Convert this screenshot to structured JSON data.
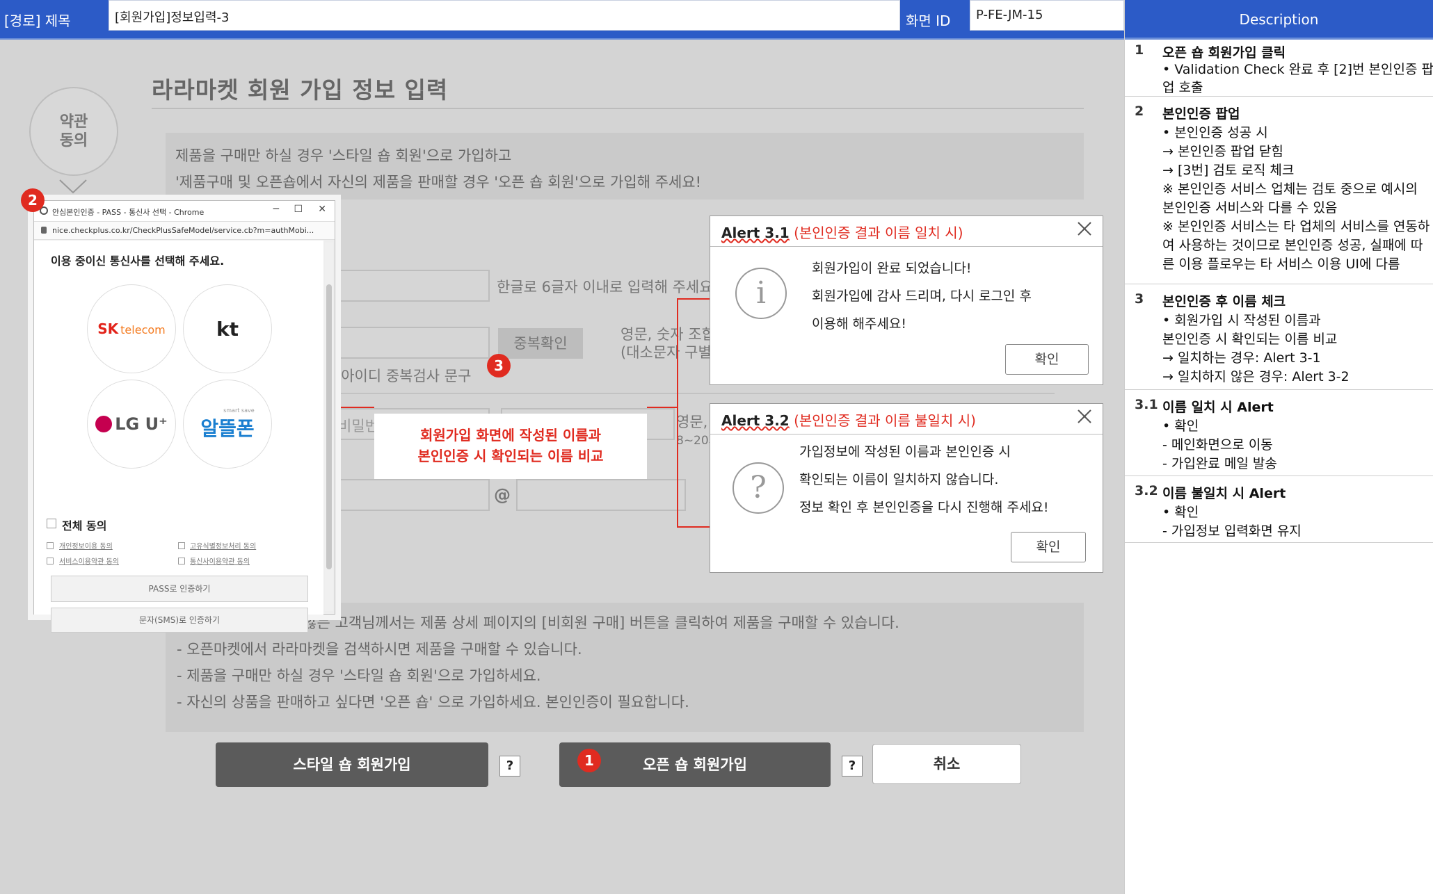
{
  "header": {
    "path_label": "[경로] 제목",
    "title_value": "[회원가입]정보입력-3",
    "screen_id_label": "화면 ID",
    "screen_id_value": "P-FE-JM-15"
  },
  "mock": {
    "page_title": "라라마켓 회원 가입 정보 입력",
    "step_label": "약관\n동의",
    "notice_top": [
      "제품을 구매만 하실 경우 '스타일 숍 회원'으로 가입하고",
      "'제품구매 및 오픈숍에서 자신의 제품을 판매할 경우 '오픈 숍 회원'으로 가입해 주세요!"
    ],
    "field_hints": {
      "name": "한글로 6글자 이내로 입력해 주세요",
      "id_line1": "영문, 숫자 조합",
      "id_line2": "(대소문자 구별",
      "id_check": "(아이디 중복검사 문구",
      "password_placeholder": "비밀번",
      "pw_hint_line1": "영문,",
      "pw_hint_line2": "8~20자",
      "at_sign": "@"
    },
    "dup_check_button": "중복확인",
    "notice_bottom": [
      "- 회원가입을 원하지 않는 고객님께서는 제품 상세 페이지의 [비회원 구매] 버튼을 클릭하여 제품을 구매할 수 있습니다.",
      "- 오픈마켓에서 라라마켓을 검색하시면 제품을 구매할 수 있습니다.",
      "- 제품을 구매만 하실 경우 '스타일 숍 회원'으로 가입하세요.",
      "- 자신의 상품을 판매하고 싶다면 '오픈 숍' 으로 가입하세요. 본인인증이 필요합니다."
    ],
    "buttons": {
      "style_shop": "스타일 숍 회원가입",
      "open_shop": "오픈 숍 회원가입",
      "cancel": "취소",
      "help": "?"
    },
    "badges": {
      "one": "1",
      "two": "2",
      "three": "3"
    },
    "callout": {
      "line1": "회원가입 화면에 작성된 이름과",
      "line2": "본인인증 시 확인되는 이름 비교"
    }
  },
  "popup": {
    "window_title": "안심본인인증 - PASS - 통신사 선택 - Chrome",
    "url": "nice.checkplus.co.kr/CheckPlusSafeModel/service.cb?m=authMobi...",
    "minimize": "─",
    "maximize": "☐",
    "close": "✕",
    "prompt": "이용 중이신 통신사를 선택해 주세요.",
    "carriers": {
      "skt_sk": "SK",
      "skt_telecom": "telecom",
      "kt": "kt",
      "lgu": "LG U⁺",
      "mvno_small": "smart save",
      "mvno": "알뜰폰"
    },
    "agree_all": "전체 동의",
    "agree_items": [
      "개인정보이용 동의",
      "고유식별정보처리 동의",
      "서비스이용약관 동의",
      "통신사이용약관 동의"
    ],
    "pass_button": "PASS로 인증하기",
    "sms_button": "문자(SMS)로 인증하기"
  },
  "alerts": [
    {
      "title": "Alert 3.1",
      "condition": "(본인인증 결과 이름 일치 시)",
      "icon": "i",
      "lines": [
        "회원가입이 완료 되었습니다!",
        "회원가입에 감사 드리며, 다시 로그인 후",
        "이용해 해주세요!"
      ],
      "button": "확인"
    },
    {
      "title": "Alert 3.2",
      "condition": "(본인인증 결과 이름 불일치 시)",
      "icon": "?",
      "lines": [
        "가입정보에 작성된 이름과 본인인증 시",
        "확인되는 이름이 일치하지 않습니다.",
        "정보 확인 후 본인인증을 다시 진행해 주세요!"
      ],
      "button": "확인"
    }
  ],
  "description": {
    "header": "Description",
    "rows": [
      {
        "num": "1",
        "title": "오픈 숍 회원가입 클릭",
        "lines": [
          "•  Validation Check 완료 후 [2]번 본인인증 팝",
          "   업 호출"
        ]
      },
      {
        "num": "2",
        "title": "본인인증 팝업",
        "lines": [
          "•  본인인증 성공 시",
          " → 본인인증 팝업 닫힘",
          " → [3번] 검토 로직 체크",
          "※ 본인인증 서비스 업체는 검토 중으로 예시의",
          "본인인증 서비스와 다를 수 있음",
          "※ 본인인증 서비스는 타 업체의 서비스를 연동하",
          "여 사용하는 것이므로 본인인증 성공, 실패에 따",
          "른 이용 플로우는 타 서비스 이용 UI에 다름"
        ]
      },
      {
        "num": "3",
        "title": "본인인증 후 이름 체크",
        "lines": [
          "•  회원가입 시 작성된 이름과",
          "   본인인증 시 확인되는 이름 비교",
          " → 일치하는 경우: Alert 3-1",
          " → 일치하지 않은 경우: Alert 3-2"
        ]
      },
      {
        "num": "3.1",
        "title": "이름 일치 시 Alert",
        "lines": [
          "•  확인",
          "- 메인화면으로 이동",
          "- 가입완료 메일 발송"
        ]
      },
      {
        "num": "3.2",
        "title": "이름 불일치 시 Alert",
        "lines": [
          "•  확인",
          "- 가입정보 입력화면 유지"
        ]
      }
    ]
  },
  "colors": {
    "header_blue": "#2c5bc7",
    "badge_red": "#e02b20",
    "mock_gray": "#d4d4d4",
    "button_dark": "#5b5b5b"
  }
}
